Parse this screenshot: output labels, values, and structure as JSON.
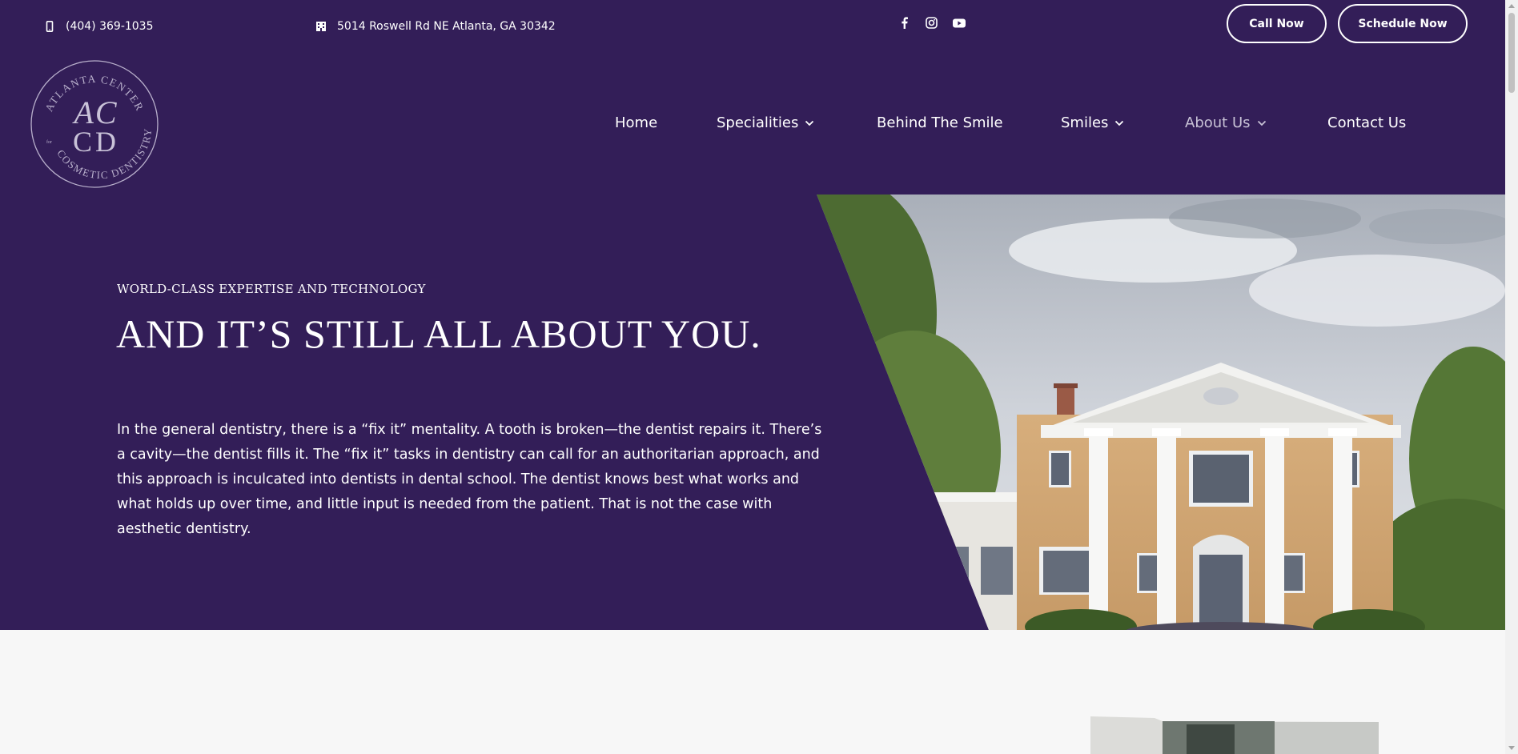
{
  "topbar": {
    "phone": "(404) 369-1035",
    "address": "5014 Roswell Rd NE Atlanta, GA 30342",
    "socials": [
      "facebook-icon",
      "instagram-icon",
      "youtube-icon"
    ],
    "call_label": "Call Now",
    "schedule_label": "Schedule Now"
  },
  "logo": {
    "top_arc": "ATLANTA CENTER",
    "bottom_arc": "COSMETIC DENTISTRY",
    "small": "for",
    "line1": "AC",
    "line2": "CD"
  },
  "nav": {
    "items": [
      {
        "label": "Home"
      },
      {
        "label": "Specialities"
      },
      {
        "label": "Behind The Smile"
      },
      {
        "label": "Smiles"
      },
      {
        "label": "About Us"
      },
      {
        "label": "Contact Us"
      }
    ]
  },
  "hero": {
    "eyebrow": "WORLD-CLASS EXPERTISE AND TECHNOLOGY",
    "headline": "AND IT’S STILL ALL ABOUT YOU.",
    "body": "In the general dentistry, there is a “fix it” mentality. A tooth is broken—the dentist repairs it. There’s a cavity—the dentist fills it. The “fix it” tasks in dentistry can call for an authoritarian approach, and this approach is inculcated into dentists in dental school. The dentist knows best what works and what holds up over time, and little input is needed from the patient. That is not the case with aesthetic dentistry."
  },
  "colors": {
    "brand_purple": "#331e58",
    "text_white": "#ffffff",
    "nav_active": "#c8c2d6",
    "section_light": "#f7f7f7"
  }
}
